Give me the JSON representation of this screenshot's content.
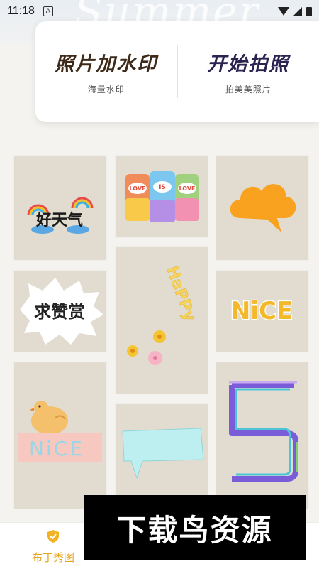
{
  "status_bar": {
    "time": "11:18",
    "notification_letter": "A"
  },
  "header": {
    "background_word": "Summer"
  },
  "top_card": {
    "left": {
      "title": "照片加水印",
      "subtitle": "海量水印"
    },
    "right": {
      "title": "开始拍照",
      "subtitle": "拍美美照片"
    }
  },
  "stickers": [
    {
      "id": "good-weather",
      "text": "好天气"
    },
    {
      "id": "love-cans",
      "labels": [
        "LOVE",
        "IS",
        "LOVE"
      ]
    },
    {
      "id": "orange-cloud"
    },
    {
      "id": "praise",
      "text": "求赞赏"
    },
    {
      "id": "happy",
      "text": "HaPPy"
    },
    {
      "id": "nice-yellow",
      "text": "NiCE"
    },
    {
      "id": "chick-nice",
      "text": "NiCE"
    },
    {
      "id": "speech-bubble"
    },
    {
      "id": "number-five",
      "text": "5"
    }
  ],
  "tabbar": {
    "tabs": [
      {
        "label": "布丁秀图",
        "active": true
      },
      {
        "label": "",
        "active": false
      },
      {
        "label": "",
        "active": false
      }
    ]
  },
  "watermark": {
    "text": "下载鸟资源"
  },
  "colors": {
    "accent": "#e9a41e",
    "tile_bg": "#e1dccf",
    "card_title_left": "#3e2a18",
    "card_title_right": "#2b2350"
  }
}
